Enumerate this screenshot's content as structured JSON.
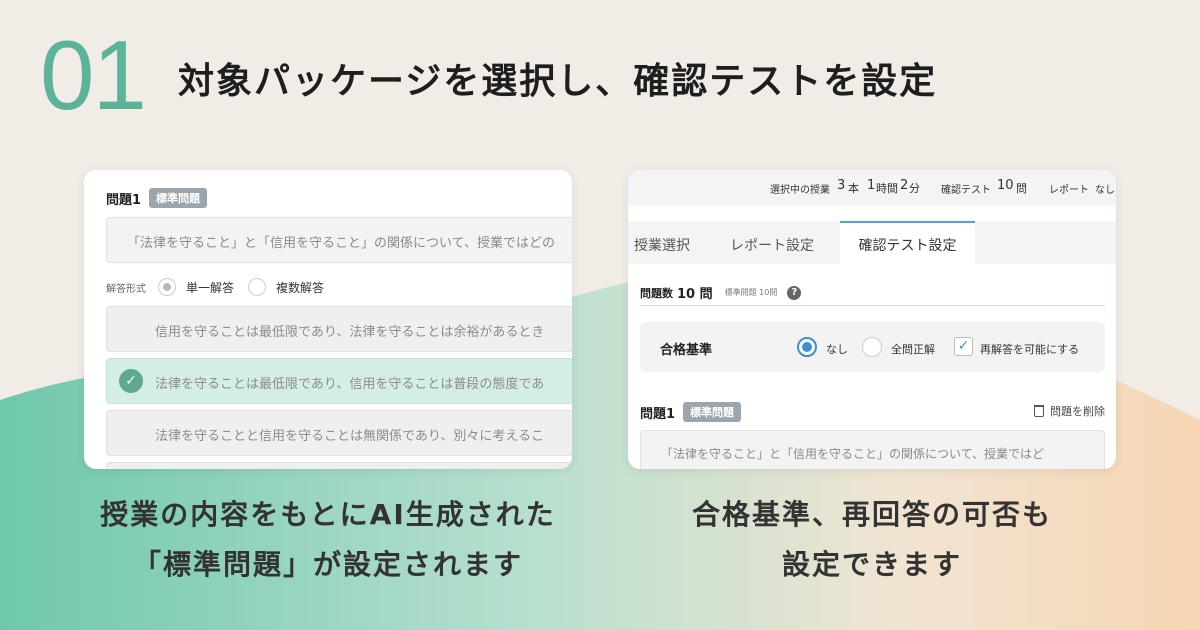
{
  "header": {
    "step_number": "01",
    "title": "対象パッケージを選択し、確認テストを設定"
  },
  "left_panel": {
    "question_title": "問題1",
    "question_badge": "標準問題",
    "question_text": "「法律を守ること」と「信用を守ること」の関係について、授業ではどの",
    "format_label": "解答形式",
    "format_single": "単一解答",
    "format_multiple": "複数解答",
    "answers": [
      "信用を守ることは最低限であり、法律を守ることは余裕があるとき",
      "法律を守ることは最低限であり、信用を守ることは普段の態度であ",
      "法律を守ることと信用を守ることは無関係であり、別々に考えるこ"
    ],
    "correct_index": 1,
    "caption_line1": "授業の内容をもとにAI生成された",
    "caption_line2": "「標準問題」が設定されます"
  },
  "right_panel": {
    "topbar": {
      "selected_label": "選択中の授業",
      "lesson_count": "3",
      "lesson_unit": "本",
      "hours": "1",
      "hours_unit": "時間",
      "minutes": "2",
      "minutes_unit": "分",
      "test_label": "確認テスト",
      "test_count": "10",
      "test_unit": "問",
      "report_label": "レポート",
      "report_value": "なし"
    },
    "tabs": [
      "授業選択",
      "レポート設定",
      "確認テスト設定"
    ],
    "active_tab": 2,
    "question_count_label": "問題数",
    "question_count_value": "10 問",
    "question_count_sub": "標準問題 10問",
    "criteria_label": "合格基準",
    "criteria_none": "なし",
    "criteria_all": "全問正解",
    "criteria_retry": "再解答を可能にする",
    "question_title": "問題1",
    "question_badge": "標準問題",
    "delete_label": "問題を削除",
    "question_text": "「法律を守ること」と「信用を守ること」の関係について、授業ではど",
    "caption_line1": "合格基準、再回答の可否も",
    "caption_line2": "設定できます"
  },
  "colors": {
    "accent_green": "#5bb49a",
    "accent_blue": "#3b8fd6",
    "badge_gray": "#9aa5ad"
  }
}
